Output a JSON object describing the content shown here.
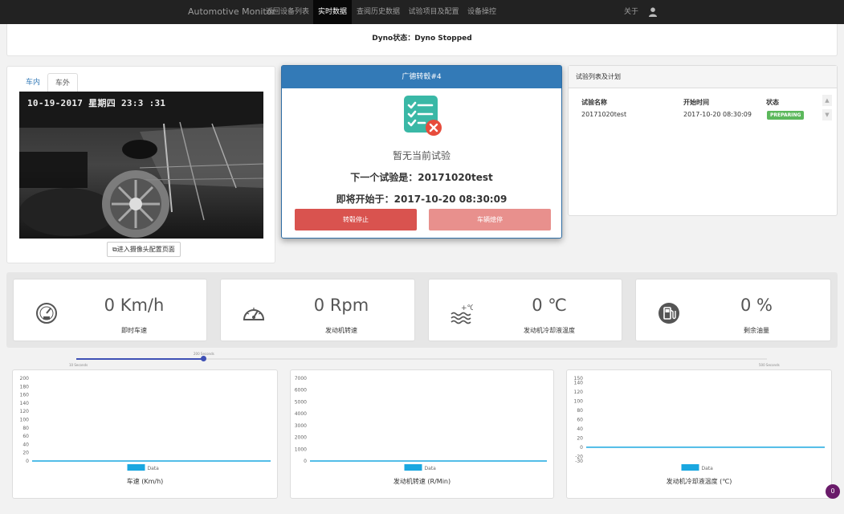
{
  "nav": {
    "brand": "Automotive Monitor",
    "items": [
      {
        "label": "返回设备列表",
        "active": false
      },
      {
        "label": "实时数据",
        "active": true
      },
      {
        "label": "查阅历史数据",
        "active": false
      },
      {
        "label": "试验项目及配置",
        "active": false
      },
      {
        "label": "设备操控",
        "active": false
      }
    ],
    "about": "关于"
  },
  "dyno": {
    "status_text": "Dyno状态：Dyno Stopped"
  },
  "camera": {
    "tabs": [
      {
        "label": "车内",
        "active": false
      },
      {
        "label": "车外",
        "active": true
      }
    ],
    "timestamp": "10-19-2017 星期四 23:3 :31",
    "config_button": "进入摄像头配置页面"
  },
  "current": {
    "header": "广德转毂#4",
    "no_test": "暂无当前试验",
    "next_test": "下一个试验是：20171020test",
    "start_at": "即将开始于：2017-10-20 08:30:09",
    "stop_roller_button": "转毂停止",
    "stop_vehicle_button": "车辆熄停"
  },
  "test_list": {
    "header": "试验列表及计划",
    "columns": [
      "试验名称",
      "开始时间",
      "状态"
    ],
    "rows": [
      {
        "name": "20171020test",
        "start": "2017-10-20 08:30:09",
        "status": "PREPARING"
      }
    ]
  },
  "gauges": [
    {
      "value": "0 Km/h",
      "label": "即时车速",
      "icon": "speedometer-icon"
    },
    {
      "value": "0 Rpm",
      "label": "发动机转速",
      "icon": "tachometer-icon"
    },
    {
      "value": "0 ℃",
      "label": "发动机冷却液温度",
      "icon": "coolant-temp-icon"
    },
    {
      "value": "0 %",
      "label": "剩余油量",
      "icon": "fuel-icon"
    }
  ],
  "timeline": {
    "left_label": "10 Seconds",
    "handle_label": "200 Seconds",
    "right_label": "500 Seconds",
    "position_fraction": 0.18
  },
  "charts_meta": {
    "legend_color": "#1aa7e0",
    "line_color": "#1aa7e0"
  },
  "chart_data": [
    {
      "type": "line",
      "title": "车速 (Km/h)",
      "ylim": [
        0,
        200
      ],
      "yticks": [
        0,
        20,
        40,
        60,
        80,
        100,
        120,
        140,
        160,
        180,
        200
      ],
      "series": [
        {
          "name": "Data",
          "values": [
            0,
            0
          ]
        }
      ],
      "grid": false,
      "legend": "bottom"
    },
    {
      "type": "line",
      "title": "发动机转速 (R/Min)",
      "ylim": [
        0,
        7000
      ],
      "yticks": [
        0,
        1000,
        2000,
        3000,
        4000,
        5000,
        6000,
        7000
      ],
      "series": [
        {
          "name": "Data",
          "values": [
            0,
            0
          ]
        }
      ],
      "grid": false,
      "legend": "bottom"
    },
    {
      "type": "line",
      "title": "发动机冷却液温度 (℃)",
      "ylim": [
        -30,
        150
      ],
      "yticks": [
        -30,
        -20,
        0,
        20,
        40,
        60,
        80,
        100,
        120,
        140,
        150
      ],
      "series": [
        {
          "name": "Data",
          "values": [
            0,
            0
          ]
        }
      ],
      "grid": false,
      "legend": "bottom"
    }
  ],
  "fab": {
    "label": "0"
  }
}
